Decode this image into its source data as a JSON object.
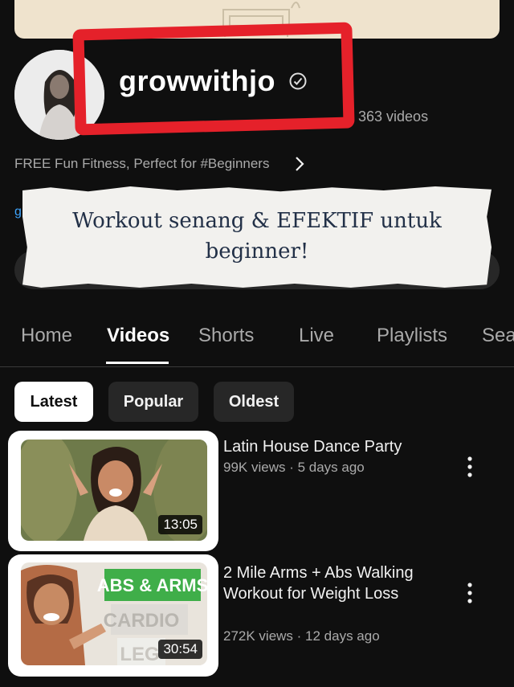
{
  "channel": {
    "name": "growwithjo",
    "video_count": "363 videos",
    "description": "FREE Fun Fitness, Perfect for #Beginners",
    "link_stub": "g"
  },
  "overlay_note": {
    "line1": "Workout senang & EFEKTIF untuk",
    "line2": "beginner!"
  },
  "tabs": [
    {
      "label": "Home"
    },
    {
      "label": "Videos"
    },
    {
      "label": "Shorts"
    },
    {
      "label": "Live"
    },
    {
      "label": "Playlists"
    },
    {
      "label": "Sea"
    }
  ],
  "filters": [
    {
      "label": "Latest"
    },
    {
      "label": "Popular"
    },
    {
      "label": "Oldest"
    }
  ],
  "videos": [
    {
      "title": "Latin House Dance Party",
      "meta": "99K views · 5 days ago",
      "duration": "13:05"
    },
    {
      "title": "2 Mile Arms + Abs Walking Workout for Weight Loss",
      "meta": "272K views · 12 days ago",
      "duration": "30:54",
      "thumb_labels": [
        "ABS & ARMS",
        "CARDIO",
        "LEG"
      ]
    }
  ],
  "colors": {
    "background": "#0f0f0f",
    "highlight_red": "#e5212a",
    "thumb_green": "#3fae49"
  }
}
